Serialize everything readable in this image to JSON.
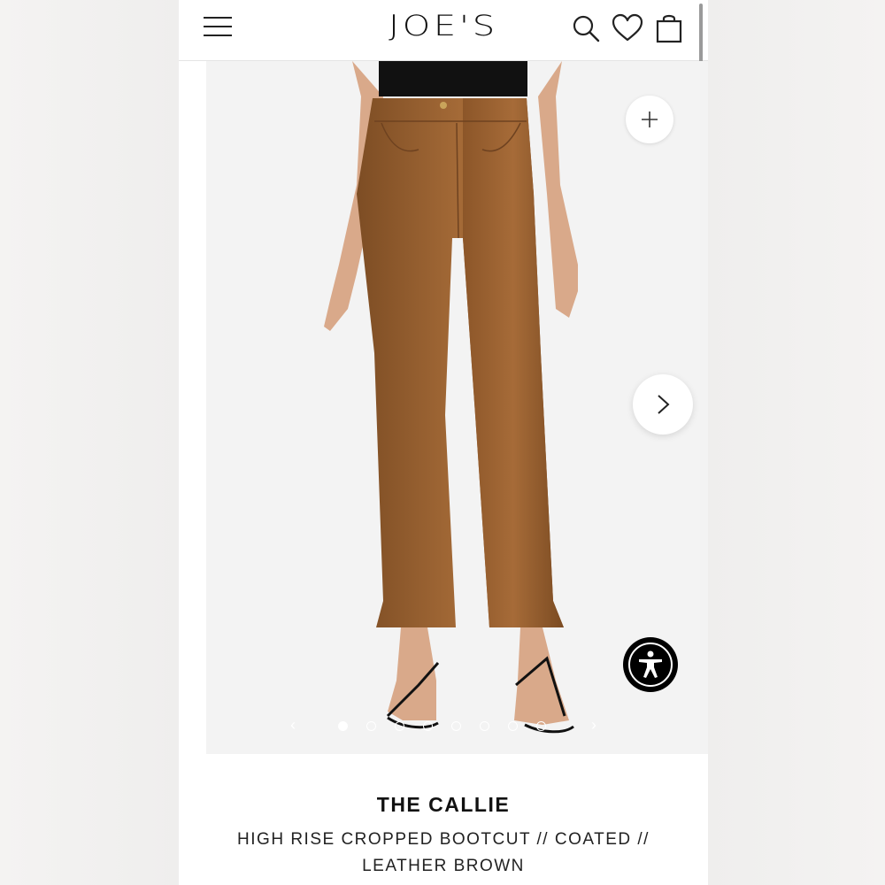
{
  "header": {
    "logo": "JOE'S",
    "menu_icon": "hamburger-menu-icon",
    "search_icon": "search-icon",
    "wishlist_icon": "heart-icon",
    "bag_icon": "shopping-bag-icon"
  },
  "gallery": {
    "zoom_icon": "plus-icon",
    "next_icon": "chevron-right-icon",
    "prev_icon": "chevron-left-icon",
    "dot_count": 8,
    "active_index": 0,
    "pants_color": "#9a6232",
    "background_color": "#f3f3f3"
  },
  "accessibility": {
    "icon": "accessibility-icon"
  },
  "product": {
    "title": "THE CALLIE",
    "subtitle_line1": "HIGH RISE CROPPED BOOTCUT // COATED //",
    "subtitle_line2": "LEATHER BROWN"
  }
}
